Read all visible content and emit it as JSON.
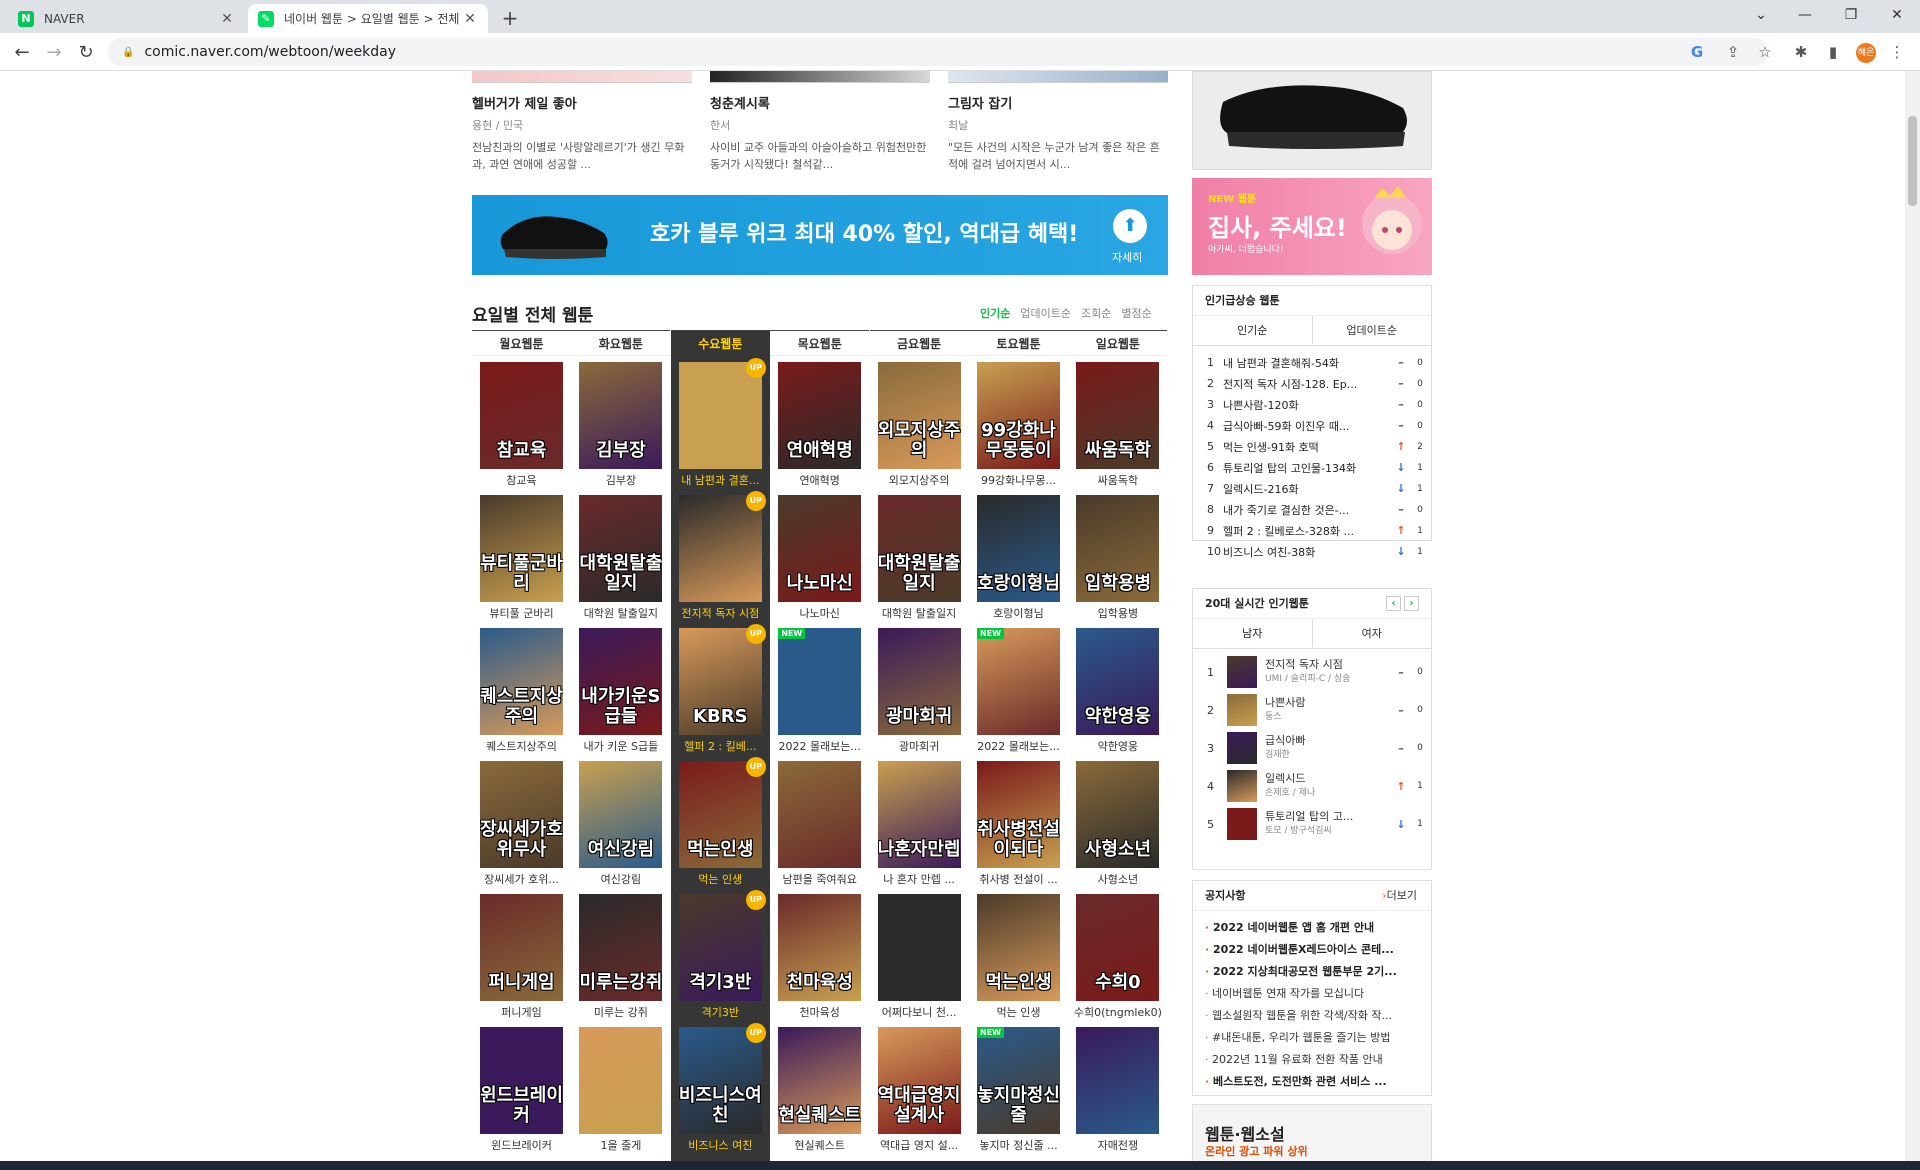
{
  "browser": {
    "tabs": [
      {
        "title": "NAVER",
        "favicon": "N"
      },
      {
        "title": "네이버 웹툰 > 요일별 웹툰 > 전체"
      }
    ],
    "url": "comic.naver.com/webtoon/weekday",
    "profile_label": "혜은"
  },
  "top_cards": [
    {
      "title": "헬버거가 제일 좋아",
      "author": "용현 / 민국",
      "desc": "전남친과의 이별로 '사랑알레르기'가 생긴 무화과, 과연 연애에 성공할 ..."
    },
    {
      "title": "청춘계시록",
      "author": "한서",
      "desc": "사이비 교주 아들과의 아슬아슬하고 위험천만한 동거가 시작됐다! 철석같..."
    },
    {
      "title": "그림자 잡기",
      "author": "최날",
      "desc": "\"모든 사건의 시작은 누군가 남겨 좋은 작은 흔적에 걸려 넘어지면서 시..."
    }
  ],
  "banner": {
    "text": "호카 블루 위크 최대 40% 할인, 역대급 혜택!",
    "more": "자세히"
  },
  "section": {
    "title": "요일별 전체 웹툰",
    "sorts": [
      "인기순",
      "업데이트순",
      "조회순",
      "별점순"
    ]
  },
  "days": [
    {
      "label": "월요웹툰",
      "items": [
        "참교육",
        "뷰티풀 군바리",
        "퀘스트지상주의",
        "장씨세가 호위...",
        "퍼니게임",
        "윈드브레이커"
      ]
    },
    {
      "label": "화요웹툰",
      "items": [
        "김부장",
        "대학원 탈출일지",
        "내가 키운 S급들",
        "여신강림",
        "미루는 강쥐",
        "1을 줄게"
      ]
    },
    {
      "label": "수요웹툰",
      "items": [
        "내 남편과 결혼...",
        "전지적 독자 시점",
        "헬퍼 2 : 킬베...",
        "먹는 인생",
        "격기3반",
        "비즈니스 여친"
      ]
    },
    {
      "label": "목요웹툰",
      "items": [
        "연애혁명",
        "나노마신",
        "2022 몰래보는...",
        "남편을 죽여줘요",
        "천마육성",
        "현실퀘스트"
      ]
    },
    {
      "label": "금요웹툰",
      "items": [
        "외모지상주의",
        "대학원 탈출일지",
        "광마회귀",
        "나 혼자 만렙 ...",
        "어쩌다보니 천...",
        "역대급 영지 설..."
      ]
    },
    {
      "label": "토요웹툰",
      "items": [
        "99강화나무몽...",
        "호랑이형님",
        "2022 몰래보는...",
        "취사병 전설이 ...",
        "먹는 인생",
        "놓지마 정신줄 ..."
      ]
    },
    {
      "label": "일요웹툰",
      "items": [
        "싸움독학",
        "입학용병",
        "약한영웅",
        "사형소년",
        "수희0(tngmlek0)",
        "자매전쟁"
      ]
    }
  ],
  "thumb_text": [
    [
      "참교육",
      "뷰티풀군바리",
      "퀘스트지상주의",
      "장씨세가호위무사",
      "퍼니게임",
      "윈드브레이커"
    ],
    [
      "김부장",
      "대학원탈출일지",
      "내가키운S급들",
      "여신강림",
      "미루는강쥐",
      ""
    ],
    [
      "",
      "",
      "KBRS",
      "먹는인생",
      "격기3반",
      "비즈니스여친"
    ],
    [
      "연애혁명",
      "나노마신",
      "",
      "",
      "천마육성",
      "현실퀘스트"
    ],
    [
      "외모지상주의",
      "대학원탈출일지",
      "광마회귀",
      "나혼자만렙",
      "",
      "역대급영지설계사"
    ],
    [
      "99강화나무몽둥이",
      "호랑이형님",
      "",
      "취사병전설이되다",
      "먹는인생",
      "놓지마정신줄"
    ],
    [
      "싸움독학",
      "입학용병",
      "약한영웅",
      "사형소년",
      "수희0",
      ""
    ]
  ],
  "colors": [
    "#7a1a1a",
    "#4a3a2a",
    "#2a5a8a",
    "#8a6a3a",
    "#6a2a2a",
    "#3a1a5a",
    "#c8a050",
    "#2a2a2a",
    "#d89a5a"
  ],
  "badges": {
    "up": "UP",
    "new": "NEW"
  },
  "sidebar": {
    "ad_new": {
      "tag": "NEW 웹툰",
      "title": "집사, 주세요!",
      "sub": "아가씨, 더럽습니다!"
    },
    "rising": {
      "title": "인기급상승 웹툰",
      "tabs": [
        "인기순",
        "업데이트순"
      ],
      "items": [
        {
          "n": "1",
          "t": "내 남편과 결혼해줘-54화",
          "dir": "eq",
          "c": "0"
        },
        {
          "n": "2",
          "t": "전지적 독자 시점-128. Ep...",
          "dir": "eq",
          "c": "0"
        },
        {
          "n": "3",
          "t": "나쁜사람-120화",
          "dir": "eq",
          "c": "0"
        },
        {
          "n": "4",
          "t": "급식아빠-59화 이진우 때...",
          "dir": "eq",
          "c": "0"
        },
        {
          "n": "5",
          "t": "먹는 인생-91화 호떡",
          "dir": "up",
          "c": "2"
        },
        {
          "n": "6",
          "t": "튜토리얼 탑의 고인물-134화",
          "dir": "dn",
          "c": "1"
        },
        {
          "n": "7",
          "t": "일렉시드-216화",
          "dir": "dn",
          "c": "1"
        },
        {
          "n": "8",
          "t": "내가 죽기로 결심한 것은-...",
          "dir": "eq",
          "c": "0"
        },
        {
          "n": "9",
          "t": "헬퍼 2 : 킬베로스-328화 ...",
          "dir": "up",
          "c": "1"
        },
        {
          "n": "10",
          "t": "비즈니스 여친-38화",
          "dir": "dn",
          "c": "1"
        }
      ]
    },
    "realtime": {
      "title": "20대 실시간 인기웹툰",
      "tabs": [
        "남자",
        "여자"
      ],
      "items": [
        {
          "n": "1",
          "t": "전지적 독자 시점",
          "a": "UMI / 슬리피-C / 싱숑",
          "dir": "eq",
          "c": "0"
        },
        {
          "n": "2",
          "t": "나쁜사람",
          "a": "둥스",
          "dir": "eq",
          "c": "0"
        },
        {
          "n": "3",
          "t": "급식아빠",
          "a": "김재한",
          "dir": "eq",
          "c": "0"
        },
        {
          "n": "4",
          "t": "일렉시드",
          "a": "손제호 / 제나",
          "dir": "up",
          "c": "1"
        },
        {
          "n": "5",
          "t": "튜토리얼 탑의 고...",
          "a": "토모 / 방구석김씨",
          "dir": "dn",
          "c": "1"
        }
      ]
    },
    "notice": {
      "title": "공지사항",
      "more": "더보기",
      "items": [
        {
          "t": "2022 네이버웹툰 앱 홈 개편 안내",
          "bold": true
        },
        {
          "t": "2022 네이버웹툰X레드아이스 콘테...",
          "bold": true
        },
        {
          "t": "2022 지상최대공모전 웹툰부문 2기...",
          "bold": true
        },
        {
          "t": "네이버웹툰 연재 작가를 모십니다",
          "bold": false
        },
        {
          "t": "웹소설원작 웹툰을 위한 각색/작화 작...",
          "bold": false
        },
        {
          "t": "#내돈내툰, 우리가 웹툰을 즐기는 방법",
          "bold": false
        },
        {
          "t": "2022년 11월 유료화 전환 작품 안내",
          "bold": false
        },
        {
          "t": "베스트도전, 도전만화 관련 서비스 ...",
          "bold": true
        }
      ]
    },
    "ad_foot": {
      "t1": "웹툰·웹소설",
      "t2": "온라인 광고 파워 상위"
    }
  }
}
